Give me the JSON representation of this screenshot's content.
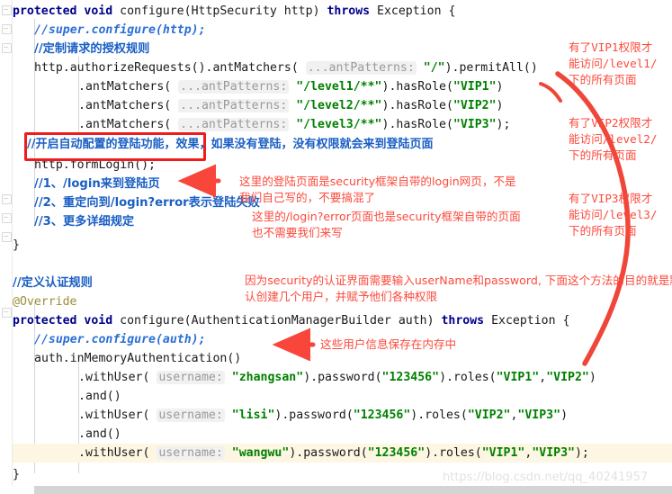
{
  "editor": {
    "language": "java",
    "watermark": "https://blog.csdn.net/qq_40241957",
    "background": "#ffffff",
    "highlight_color": "#fdf6e3",
    "annotation_color": "#fb4a3c",
    "comment_color": "#1a5fc4",
    "string_color": "#008000",
    "keyword_color": "#00008b"
  },
  "code": {
    "lines": [
      {
        "id": "l1",
        "indent": 0,
        "text": "protected void configure(HttpSecurity http) throws Exception {"
      },
      {
        "id": "l2",
        "indent": 1,
        "text": "//super.configure(http);"
      },
      {
        "id": "l3",
        "indent": 1,
        "text": "//定制请求的授权规则"
      },
      {
        "id": "l4",
        "indent": 1,
        "text": "http.authorizeRequests().antMatchers( ...antPatterns: \"/\").permitAll()"
      },
      {
        "id": "l5",
        "indent": 3,
        "text": ".antMatchers( ...antPatterns: \"/level1/**\").hasRole(\"VIP1\")"
      },
      {
        "id": "l6",
        "indent": 3,
        "text": ".antMatchers( ...antPatterns: \"/level2/**\").hasRole(\"VIP2\")"
      },
      {
        "id": "l7",
        "indent": 3,
        "text": ".antMatchers( ...antPatterns: \"/level3/**\").hasRole(\"VIP3\");"
      },
      {
        "id": "l8",
        "indent": 1,
        "text": "//开启自动配置的登陆功能，效果，如果没有登陆，没有权限就会来到登陆页面"
      },
      {
        "id": "l9",
        "indent": 1,
        "text": "http.formLogin();"
      },
      {
        "id": "l10",
        "indent": 1,
        "text": "//1、/login来到登陆页"
      },
      {
        "id": "l11",
        "indent": 1,
        "text": "//2、重定向到/login?error表示登陆失败"
      },
      {
        "id": "l12",
        "indent": 1,
        "text": "//3、更多详细规定"
      },
      {
        "id": "l13",
        "indent": 0,
        "text": "}"
      },
      {
        "id": "l14",
        "indent": 0,
        "text": "//定义认证规则"
      },
      {
        "id": "l15",
        "indent": 0,
        "text": "@Override"
      },
      {
        "id": "l16",
        "indent": 0,
        "text": "protected void configure(AuthenticationManagerBuilder auth) throws Exception {"
      },
      {
        "id": "l17",
        "indent": 1,
        "text": "//super.configure(auth);"
      },
      {
        "id": "l18",
        "indent": 1,
        "text": "auth.inMemoryAuthentication()"
      },
      {
        "id": "l19",
        "indent": 3,
        "text": ".withUser( username: \"zhangsan\").password(\"123456\").roles(\"VIP1\",\"VIP2\")"
      },
      {
        "id": "l20",
        "indent": 3,
        "text": ".and()"
      },
      {
        "id": "l21",
        "indent": 3,
        "text": ".withUser( username: \"lisi\").password(\"123456\").roles(\"VIP2\",\"VIP3\")"
      },
      {
        "id": "l22",
        "indent": 3,
        "text": ".and()"
      },
      {
        "id": "l23",
        "indent": 3,
        "text": ".withUser( username: \"wangwu\").password(\"123456\").roles(\"VIP1\",\"VIP3\");"
      },
      {
        "id": "l24",
        "indent": 0,
        "text": "}"
      }
    ],
    "tokens": {
      "keyword_protected": "protected",
      "keyword_void": "void",
      "keyword_throws": "throws",
      "method_configure": "configure",
      "type_httpsecurity": "HttpSecurity",
      "type_authmanagerbuilder": "AuthenticationManagerBuilder",
      "type_exception": "Exception",
      "param_http": "http",
      "param_auth": "auth",
      "annotation_override": "@Override",
      "param_hint_antpatterns": "...antPatterns:",
      "param_hint_username": "username:",
      "str_root": "\"/\"",
      "str_level1": "\"/level1/**\"",
      "str_level2": "\"/level2/**\"",
      "str_level3": "\"/level3/**\"",
      "str_vip1": "\"VIP1\"",
      "str_vip2": "\"VIP2\"",
      "str_vip3": "\"VIP3\"",
      "str_zhangsan": "\"zhangsan\"",
      "str_lisi": "\"lisi\"",
      "str_wangwu": "\"wangwu\"",
      "str_password": "\"123456\""
    }
  },
  "annotations": {
    "redbox_label": "//开启自动配置的登陆功能，",
    "notes": [
      {
        "id": "n1",
        "lines": [
          "有了VIP1权限才",
          "能访问/level1/",
          "下的所有页面"
        ]
      },
      {
        "id": "n2",
        "lines": [
          "有了VIP2权限才",
          "能访问/level2/",
          "下的所有页面"
        ]
      },
      {
        "id": "n3",
        "lines": [
          "有了VIP3权限才",
          "能访问/level3/",
          "下的所有页面"
        ]
      },
      {
        "id": "n4",
        "lines": [
          "这里的登陆页面是security框架自带的login网页，不是",
          "我们自己写的，不要搞混了"
        ]
      },
      {
        "id": "n5",
        "lines": [
          "这里的/login?error页面也是security框架自带的页面",
          "也不需要我们来写"
        ]
      },
      {
        "id": "n6",
        "lines": [
          "因为security的认证界面需要输入userName和password, 下面这个方法的目的就是默",
          "认创建几个用户，并赋予他们各种权限"
        ]
      },
      {
        "id": "n7",
        "lines": [
          "这些用户信息保存在内存中"
        ]
      }
    ]
  }
}
